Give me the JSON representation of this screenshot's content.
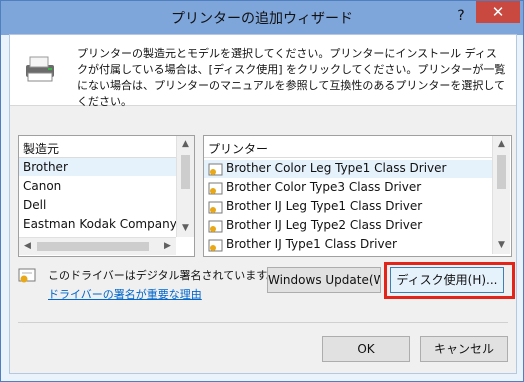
{
  "window": {
    "title": "プリンターの追加ウィザード",
    "help_glyph": "?",
    "close_glyph": "✕"
  },
  "intro": {
    "text": "プリンターの製造元とモデルを選択してください。プリンターにインストール ディスクが付属している場合は、[ディスク使用] をクリックしてください。プリンターが一覧にない場合は、プリンターのマニュアルを参照して互換性のあるプリンターを選択してください。",
    "icon": "printer-icon"
  },
  "manufacturers": {
    "header": "製造元",
    "items": [
      "Brother",
      "Canon",
      "Dell",
      "Eastman Kodak Company"
    ],
    "selected": "Brother"
  },
  "printers": {
    "header": "プリンター",
    "items": [
      "Brother Color Leg Type1 Class Driver",
      "Brother Color Type3 Class Driver",
      "Brother IJ Leg Type1 Class Driver",
      "Brother IJ Leg Type2 Class Driver",
      "Brother IJ Type1 Class Driver"
    ],
    "selected": "Brother Color Leg Type1 Class Driver"
  },
  "signature": {
    "status": "このドライバーはデジタル署名されています。",
    "link": "ドライバーの署名が重要な理由"
  },
  "buttons": {
    "windows_update": "Windows Update(W)",
    "have_disk": "ディスク使用(H)...",
    "ok": "OK",
    "cancel": "キャンセル"
  },
  "colors": {
    "titlebar": "#7ea6db",
    "close": "#c9483f",
    "highlight": "#e2241b",
    "link": "#0066cc"
  }
}
